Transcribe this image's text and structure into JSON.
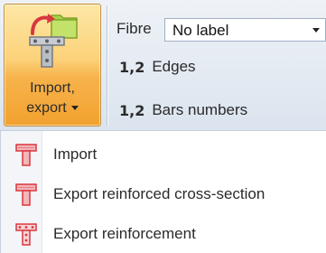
{
  "ribbon": {
    "import_export": {
      "label_line1": "Import,",
      "label_line2": "export",
      "icon": "import-export-icon"
    },
    "fibre": {
      "label": "Fibre",
      "selected": "No label"
    },
    "rows": [
      {
        "glyph": "1,2",
        "label": "Edges"
      },
      {
        "glyph": "1,2",
        "label": "Bars numbers"
      }
    ]
  },
  "menu": {
    "items": [
      {
        "label": "Import",
        "icon": "section-import-icon"
      },
      {
        "label": "Export reinforced cross-section",
        "icon": "section-export-icon"
      },
      {
        "label": "Export reinforcement",
        "icon": "reinforcement-export-icon"
      }
    ]
  },
  "colors": {
    "button_top": "#fde7a6",
    "button_bottom": "#f2a12e",
    "icon_red": "#d9363e",
    "folder_green": "#9ccb3c"
  }
}
